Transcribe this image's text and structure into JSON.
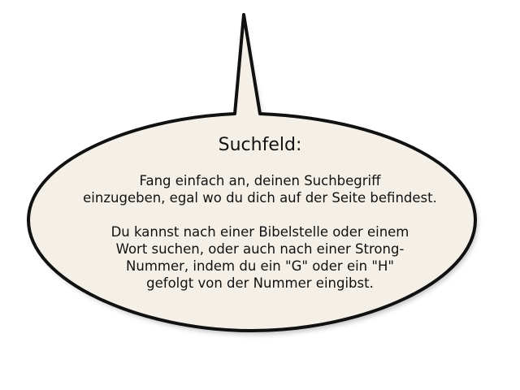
{
  "tooltip": {
    "title": "Suchfeld:",
    "paragraphs": [
      {
        "lines": [
          "Fang einfach an, deinen Suchbegriff",
          "einzugeben, egal wo du dich auf der Seite befindest."
        ]
      },
      {
        "lines": [
          "Du kannst nach einer Bibelstelle oder einem",
          "Wort suchen, oder auch nach einer Strong-",
          "Nummer, indem du ein \"G\" oder ein \"H\"",
          "gefolgt von der Nummer eingibst."
        ]
      }
    ],
    "colors": {
      "fill": "#f4f0e8",
      "stroke": "#111111",
      "shadow": "#9a9a9a",
      "text": "#111111"
    }
  }
}
